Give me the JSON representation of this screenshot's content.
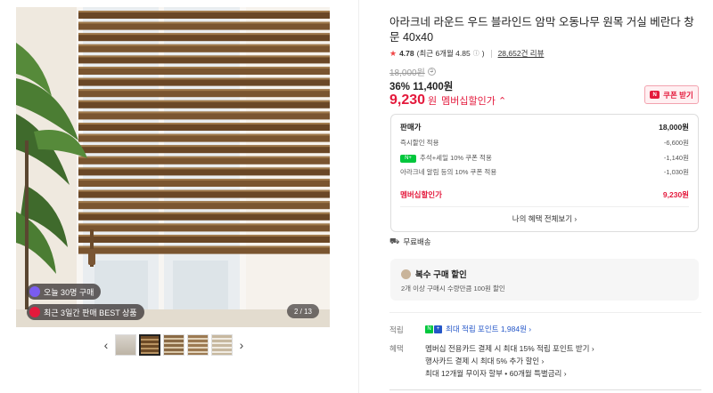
{
  "gallery": {
    "badges": [
      {
        "text": "오늘 30명 구매",
        "icon": "shopping-bag-icon",
        "color": "#7a5cf0"
      },
      {
        "text": "최근 3일간 판매 BEST 상품",
        "icon": "crown-icon",
        "color": "#e4193c"
      }
    ],
    "counter": "2 / 13",
    "prev_arrow": "‹",
    "next_arrow": "›",
    "thumb_count": 5,
    "active_thumb": 1
  },
  "product": {
    "title": "아라크네 라운드 우드 블라인드 암막 오동나무 원목 거실 베란다 창문 40x40",
    "rating": "4.78",
    "rating_recent": "(최근 6개월 4.85",
    "rating_recent_close": ")",
    "reviews": "28,652건 리뷰",
    "original_price": "18,000원",
    "sale": "36% 11,400원",
    "member_price": "9,230",
    "member_price_unit": "원",
    "member_price_label": "멤버십할인가 ⌃",
    "coupon_button": "쿠폰 받기"
  },
  "breakdown": {
    "head_label": "판매가",
    "head_value": "18,000원",
    "rows": [
      {
        "label": "즉시할인 적용",
        "value": "-6,600원"
      },
      {
        "label": "추석+세일 10% 쿠폰 적용",
        "value": "-1,140원",
        "badge": "N+"
      },
      {
        "label": "아라크네 알림 등의 10% 쿠폰 적용",
        "value": "-1,030원"
      }
    ],
    "total_label": "멤버십할인가",
    "total_value": "9,230원",
    "all_benefits": "나의 혜택 전체보기 ›"
  },
  "shipping": {
    "text": "무료배송",
    "icon": "truck-icon"
  },
  "multi_discount": {
    "title": "복수 구매 할인",
    "desc": "2개 이상 구매시 수량만큼 100원 할인"
  },
  "points": {
    "label": "적립",
    "text": "최대 적립 포인트 1,984원 ›"
  },
  "benefits": {
    "label": "혜택",
    "items": [
      "멤버십 전용카드 결제 시 최대 15% 적립 포인트 받기 ›",
      "행사카드 결제 시 최대 5% 추가 할인 ›",
      "최대 12개월 무이자 할부 • 60개월 특별금리 ›"
    ]
  },
  "colors": {
    "accent": "#e4193c",
    "link": "#2456c8",
    "naver_green": "#00c73c"
  }
}
